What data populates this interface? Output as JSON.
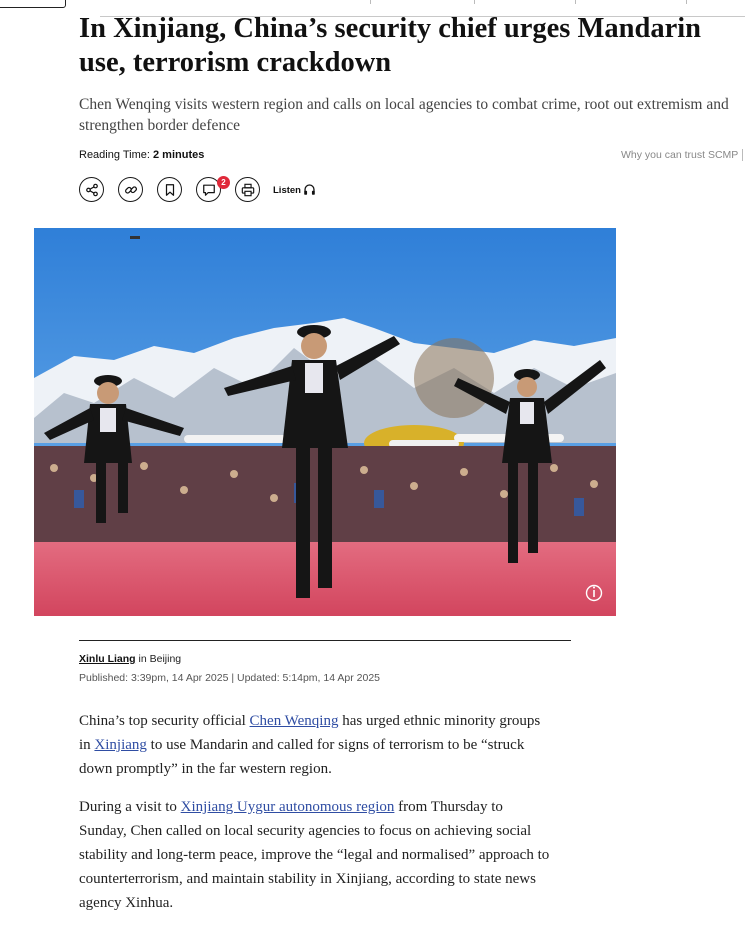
{
  "article": {
    "headline": "In Xinjiang, China’s security chief urges Mandarin use, terrorism crackdown",
    "subheadline": "Chen Wenqing visits western region and calls on local agencies to combat crime, root out extremism and strengthen border defence",
    "reading_time_label": "Reading Time:",
    "reading_time_value": "2 minutes",
    "trust_link": "Why you can trust SCMP",
    "comment_count": "2",
    "listen_label": "Listen",
    "byline": {
      "author": "Xinlu Liang",
      "location": "in Beijing",
      "published": "Published: 3:39pm, 14 Apr 2025 | Updated: 5:14pm, 14 Apr 2025"
    },
    "paragraphs": [
      {
        "parts": [
          {
            "text": "China’s top security official "
          },
          {
            "text": "Chen Wenqing",
            "link": true
          },
          {
            "text": " has urged ethnic minority groups in "
          },
          {
            "text": "Xinjiang",
            "link": true
          },
          {
            "text": " to use Mandarin and called for signs of terrorism to be “struck down promptly” in the far western region."
          }
        ]
      },
      {
        "parts": [
          {
            "text": "During a visit to "
          },
          {
            "text": "Xinjiang Uygur autonomous region",
            "link": true
          },
          {
            "text": " from Thursday to Sunday, Chen called on local security agencies to focus on achieving social stability and long-term peace, improve the “legal and normalised” approach to counterterrorism, and maintain stability in Xinjiang, according to state news agency Xinhua."
          }
        ]
      }
    ]
  },
  "icons": {
    "share": "share-icon",
    "link": "link-icon",
    "bookmark": "bookmark-icon",
    "comment": "comment-icon",
    "print": "print-icon",
    "listen": "headphones-icon",
    "info": "info-icon"
  },
  "colors": {
    "link": "#2f4da3",
    "badge": "#e0293a",
    "sky": "#3f8fde",
    "stage": "#d9536a"
  }
}
